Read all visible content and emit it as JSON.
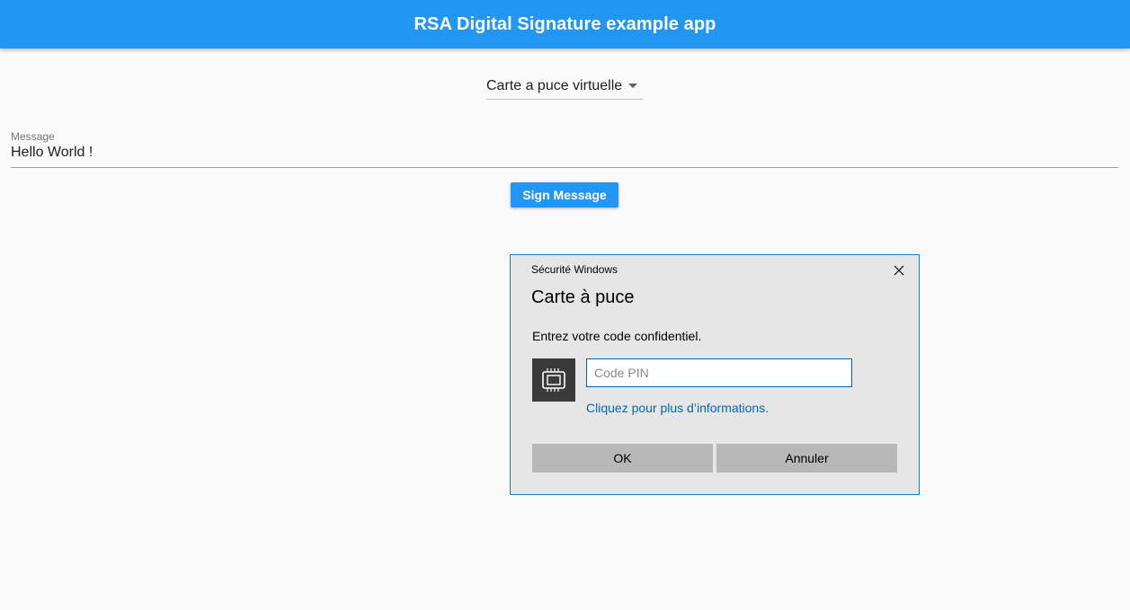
{
  "app": {
    "title": "RSA Digital Signature example app"
  },
  "reader_select": {
    "selected": "Carte a puce virtuelle"
  },
  "message_field": {
    "label": "Message",
    "value": "Hello World !"
  },
  "sign_button": {
    "label": "Sign Message"
  },
  "dialog": {
    "header": "Sécurité Windows",
    "title": "Carte à puce",
    "prompt": "Entrez votre code confidentiel.",
    "pin_placeholder": "Code PIN",
    "pin_value": "",
    "info_link": "Cliquez pour plus d’informations.",
    "ok_label": "OK",
    "cancel_label": "Annuler",
    "icons": {
      "close": "close-icon",
      "chip": "smartcard-chip-icon"
    }
  },
  "colors": {
    "app_bar": "#2196f3",
    "primary_button": "#2196f3",
    "dialog_border": "#1979ca",
    "dialog_background": "#e6e6e6",
    "link": "#0066b4",
    "dialog_button": "#b8b8b8"
  }
}
